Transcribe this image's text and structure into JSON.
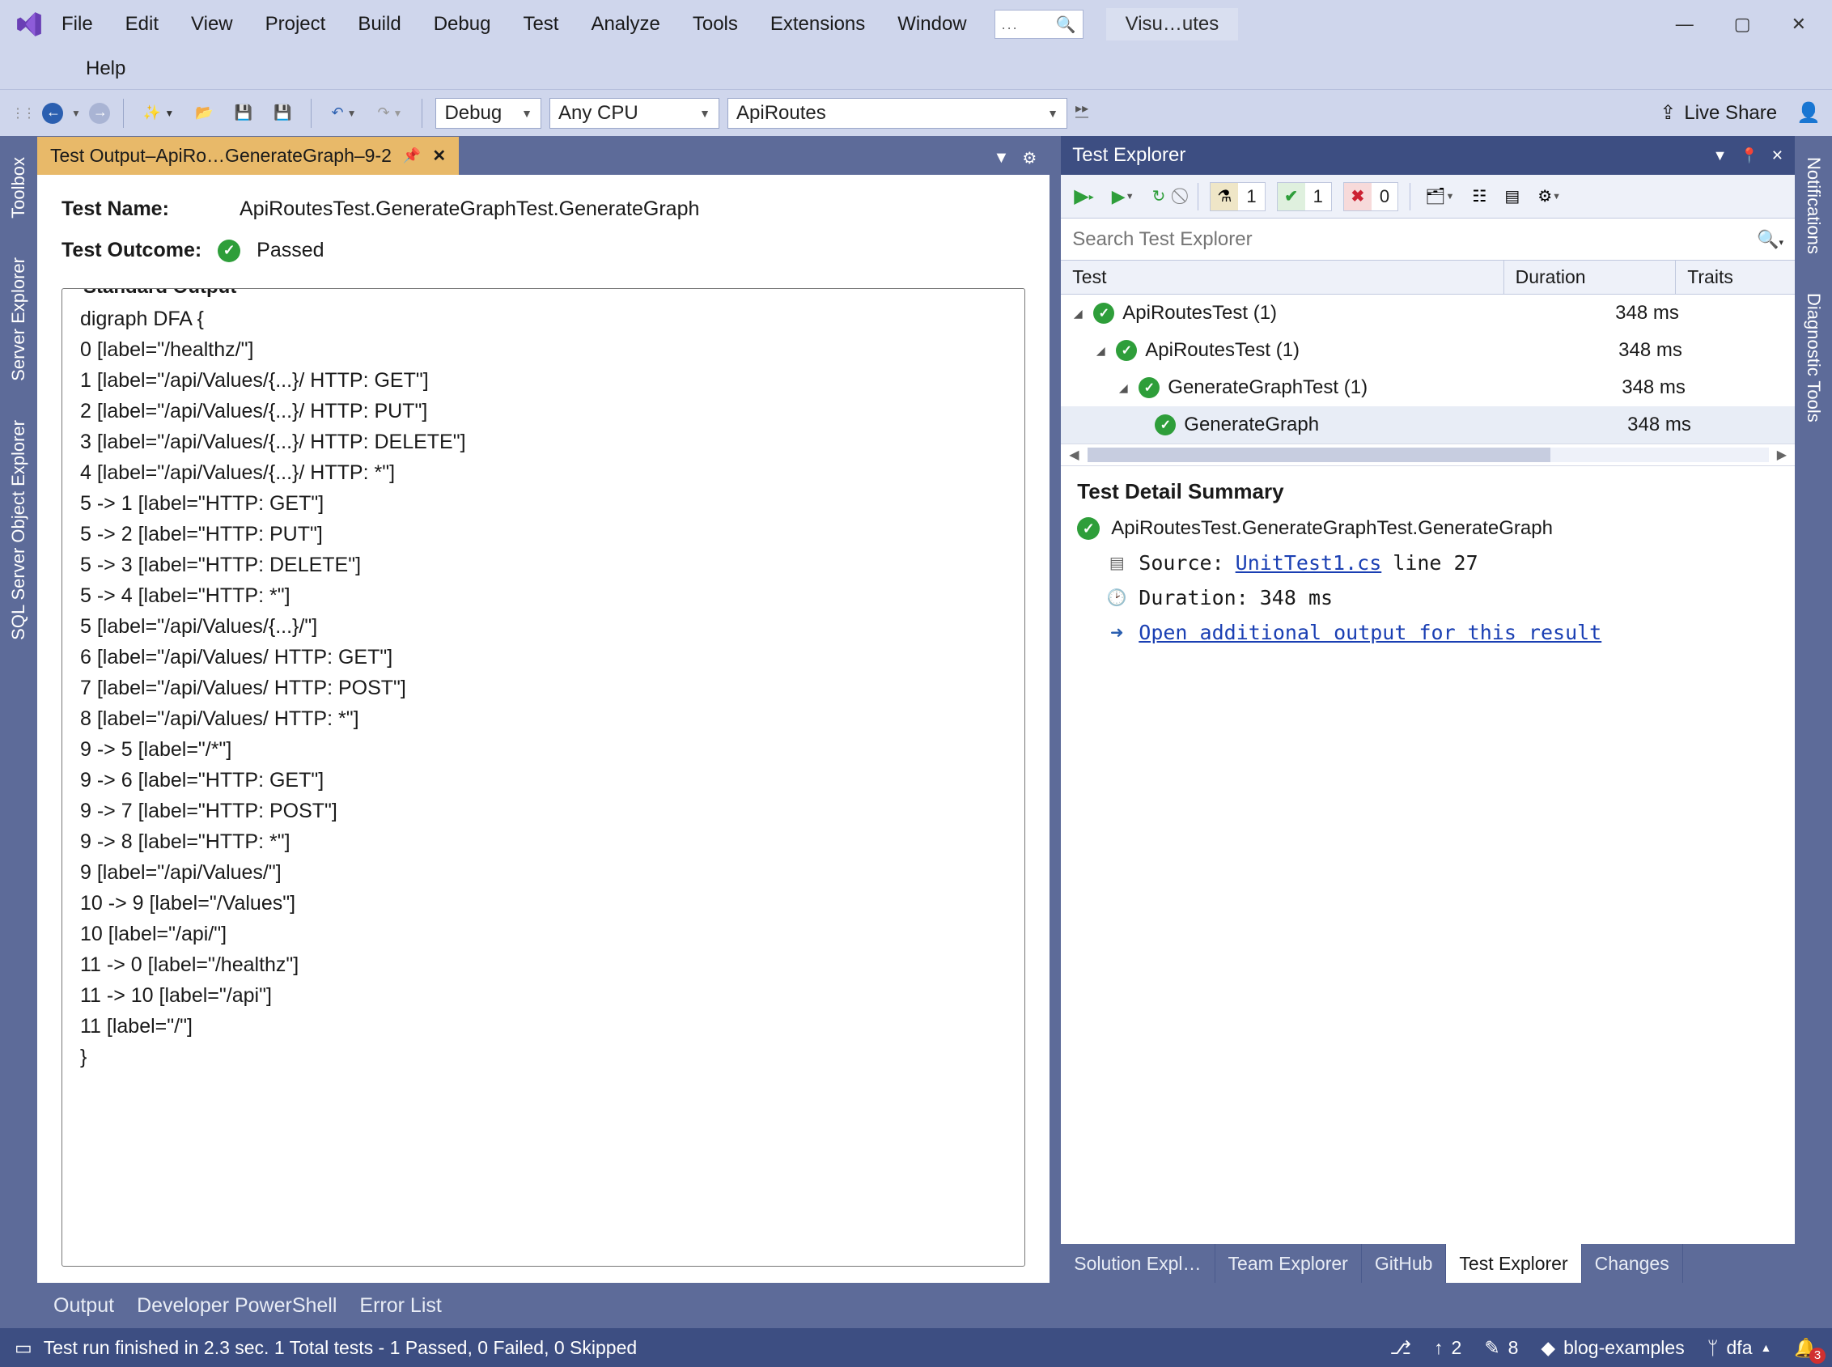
{
  "title_bar": {
    "app_title": "Visu…utes",
    "menus_row1": [
      "File",
      "Edit",
      "View",
      "Project",
      "Build",
      "Debug",
      "Test",
      "Analyze",
      "Tools",
      "Extensions",
      "Window"
    ],
    "menus_row2": [
      "Help"
    ],
    "search_placeholder": "..."
  },
  "toolbar": {
    "config": "Debug",
    "platform": "Any CPU",
    "startup": "ApiRoutes",
    "live_share": "Live Share"
  },
  "left_tabs": [
    "Toolbox",
    "Server Explorer",
    "SQL Server Object Explorer"
  ],
  "right_tabs": [
    "Notifications",
    "Diagnostic Tools"
  ],
  "doc": {
    "tab_title": "Test Output–ApiRo…GenerateGraph–9-2",
    "test_name_label": "Test Name:",
    "test_name_value": "ApiRoutesTest.GenerateGraphTest.GenerateGraph",
    "outcome_label": "Test Outcome:",
    "outcome_value": "Passed",
    "stdout_legend": "Standard Output",
    "stdout": "digraph DFA {\n0 [label=\"/healthz/\"]\n1 [label=\"/api/Values/{...}/ HTTP: GET\"]\n2 [label=\"/api/Values/{...}/ HTTP: PUT\"]\n3 [label=\"/api/Values/{...}/ HTTP: DELETE\"]\n4 [label=\"/api/Values/{...}/ HTTP: *\"]\n5 -> 1 [label=\"HTTP: GET\"]\n5 -> 2 [label=\"HTTP: PUT\"]\n5 -> 3 [label=\"HTTP: DELETE\"]\n5 -> 4 [label=\"HTTP: *\"]\n5 [label=\"/api/Values/{...}/\"]\n6 [label=\"/api/Values/ HTTP: GET\"]\n7 [label=\"/api/Values/ HTTP: POST\"]\n8 [label=\"/api/Values/ HTTP: *\"]\n9 -> 5 [label=\"/*\"]\n9 -> 6 [label=\"HTTP: GET\"]\n9 -> 7 [label=\"HTTP: POST\"]\n9 -> 8 [label=\"HTTP: *\"]\n9 [label=\"/api/Values/\"]\n10 -> 9 [label=\"/Values\"]\n10 [label=\"/api/\"]\n11 -> 0 [label=\"/healthz\"]\n11 -> 10 [label=\"/api\"]\n11 [label=\"/\"]\n}"
  },
  "bottom_panels": [
    "Output",
    "Developer PowerShell",
    "Error List"
  ],
  "test_explorer": {
    "title": "Test Explorer",
    "counts": {
      "total": "1",
      "passed": "1",
      "failed": "0"
    },
    "search_placeholder": "Search Test Explorer",
    "columns": {
      "test": "Test",
      "duration": "Duration",
      "traits": "Traits"
    },
    "tree": [
      {
        "level": 0,
        "name": "ApiRoutesTest (1)",
        "duration": "348 ms",
        "sel": false
      },
      {
        "level": 1,
        "name": "ApiRoutesTest (1)",
        "duration": "348 ms",
        "sel": false
      },
      {
        "level": 2,
        "name": "GenerateGraphTest (1)",
        "duration": "348 ms",
        "sel": false
      },
      {
        "level": 3,
        "name": "GenerateGraph",
        "duration": "348 ms",
        "sel": true
      }
    ],
    "detail": {
      "heading": "Test Detail Summary",
      "full_name": "ApiRoutesTest.GenerateGraphTest.GenerateGraph",
      "source_label": "Source:",
      "source_file": "UnitTest1.cs",
      "source_line": "line 27",
      "duration_label": "Duration:",
      "duration_value": "348 ms",
      "open_output": "Open additional output for this result"
    },
    "bottom_tabs": [
      "Solution Expl…",
      "Team Explorer",
      "GitHub",
      "Test Explorer",
      "Changes"
    ],
    "active_bottom_tab": 3
  },
  "status": {
    "left_icon_label": "test-result-icon",
    "message": "Test run finished in 2.3 sec. 1 Total tests - 1 Passed, 0 Failed, 0 Skipped",
    "pr": "2",
    "edits": "8",
    "repo": "blog-examples",
    "branch": "dfa",
    "notifications": "3"
  }
}
